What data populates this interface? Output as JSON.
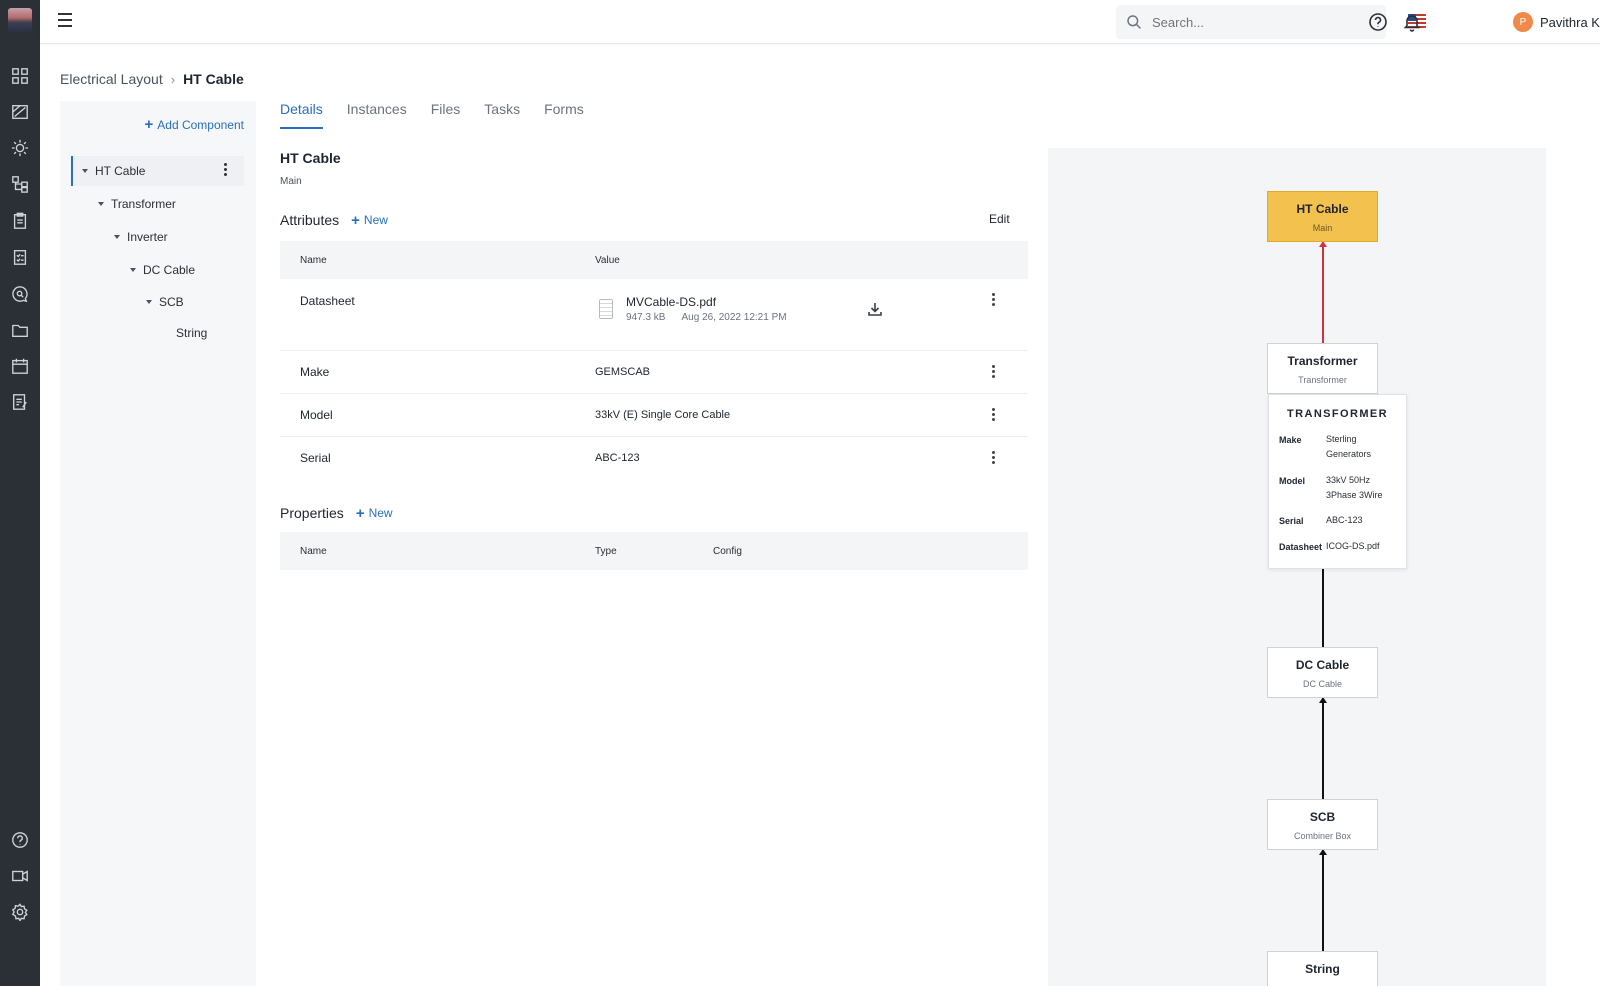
{
  "header": {
    "search_placeholder": "Search...",
    "user_initial": "P",
    "user_name": "Pavithra K"
  },
  "breadcrumb": {
    "parent": "Electrical Layout",
    "separator": "›",
    "current": "HT Cable"
  },
  "tree": {
    "add_label": "Add Component",
    "items": [
      {
        "label": "HT Cable"
      },
      {
        "label": "Transformer"
      },
      {
        "label": "Inverter"
      },
      {
        "label": "DC Cable"
      },
      {
        "label": "SCB"
      },
      {
        "label": "String"
      }
    ]
  },
  "tabs": [
    "Details",
    "Instances",
    "Files",
    "Tasks",
    "Forms"
  ],
  "entity": {
    "title": "HT Cable",
    "subtitle": "Main"
  },
  "attributes": {
    "heading": "Attributes",
    "new_label": "New",
    "edit_label": "Edit",
    "columns": {
      "name": "Name",
      "value": "Value"
    },
    "file": {
      "row_name": "Datasheet",
      "file_name": "MVCable-DS.pdf",
      "size": "947.3 kB",
      "date": "Aug 26, 2022 12:21 PM"
    },
    "rows": [
      {
        "name": "Make",
        "value": "GEMSCAB"
      },
      {
        "name": "Model",
        "value": "33kV (E) Single Core Cable"
      },
      {
        "name": "Serial",
        "value": "ABC-123"
      }
    ]
  },
  "properties": {
    "heading": "Properties",
    "new_label": "New",
    "columns": {
      "name": "Name",
      "type": "Type",
      "config": "Config"
    }
  },
  "diagram": {
    "nodes": [
      {
        "title": "HT Cable",
        "subtitle": "Main"
      },
      {
        "title": "Transformer",
        "subtitle": "Transformer"
      },
      {
        "title": "DC Cable",
        "subtitle": "DC Cable"
      },
      {
        "title": "SCB",
        "subtitle": "Combiner Box"
      },
      {
        "title": "String",
        "subtitle": ""
      }
    ],
    "highlight_color": "#f3c14d",
    "active_link_color": "#d0343a",
    "tooltip": {
      "title": "TRANSFORMER",
      "make_label": "Make",
      "make_value": "Sterling Generators",
      "model_label": "Model",
      "model_value": "33kV 50Hz 3Phase 3Wire",
      "serial_label": "Serial",
      "serial_value": "ABC-123",
      "datasheet_label": "Datasheet",
      "datasheet_value": "ICOG-DS.pdf"
    }
  },
  "colors": {
    "accent": "#2a6fbd",
    "rail": "#2b2f36"
  },
  "icons": {
    "rail": [
      "dashboard-icon",
      "layout-icon",
      "sun-icon",
      "hierarchy-icon",
      "clipboard-icon",
      "checklist-icon",
      "chat-search-icon",
      "folder-icon",
      "calendar-icon",
      "report-icon",
      "help-icon",
      "video-icon",
      "settings-icon"
    ]
  }
}
